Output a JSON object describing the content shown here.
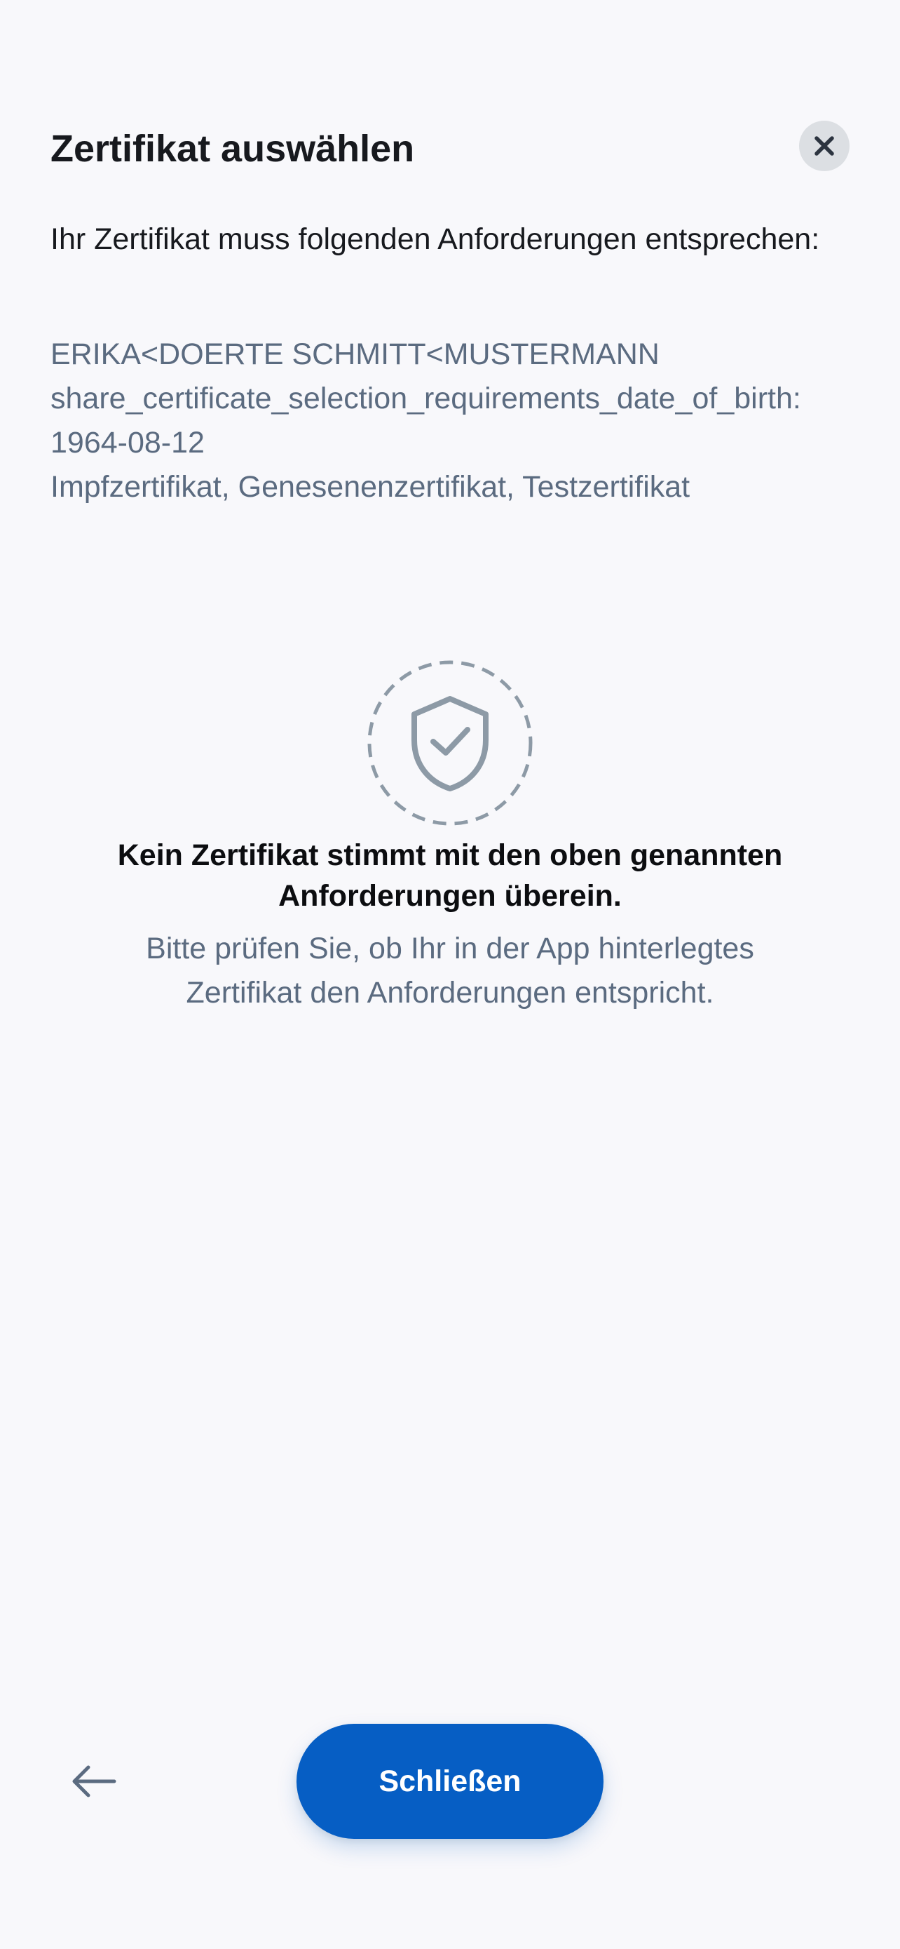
{
  "header": {
    "title": "Zertifikat auswählen",
    "close_icon": "close-icon"
  },
  "requirements": {
    "intro": "Ihr Zertifikat muss folgenden Anforderungen entsprechen:",
    "name": "ERIKA<DOERTE SCHMITT<MUSTERMANN",
    "date_of_birth": "share_certificate_selection_requirements_date_of_birth: 1964-08-12",
    "types": "Impfzertifikat, Genesenenzertifikat, Testzertifikat"
  },
  "empty_state": {
    "icon": "shield-check-icon",
    "title": "Kein Zertifikat stimmt mit den oben genannten Anforderungen überein.",
    "description": "Bitte prüfen Sie, ob Ihr in der App hinterlegtes Zertifikat den Anforderungen entspricht."
  },
  "footer": {
    "back_icon": "arrow-left-icon",
    "close_label": "Schließen"
  },
  "colors": {
    "background": "#f8f8fb",
    "primary": "#065ec4",
    "secondary_text": "#5b6b80",
    "icon_gray": "#8d9aa6"
  }
}
